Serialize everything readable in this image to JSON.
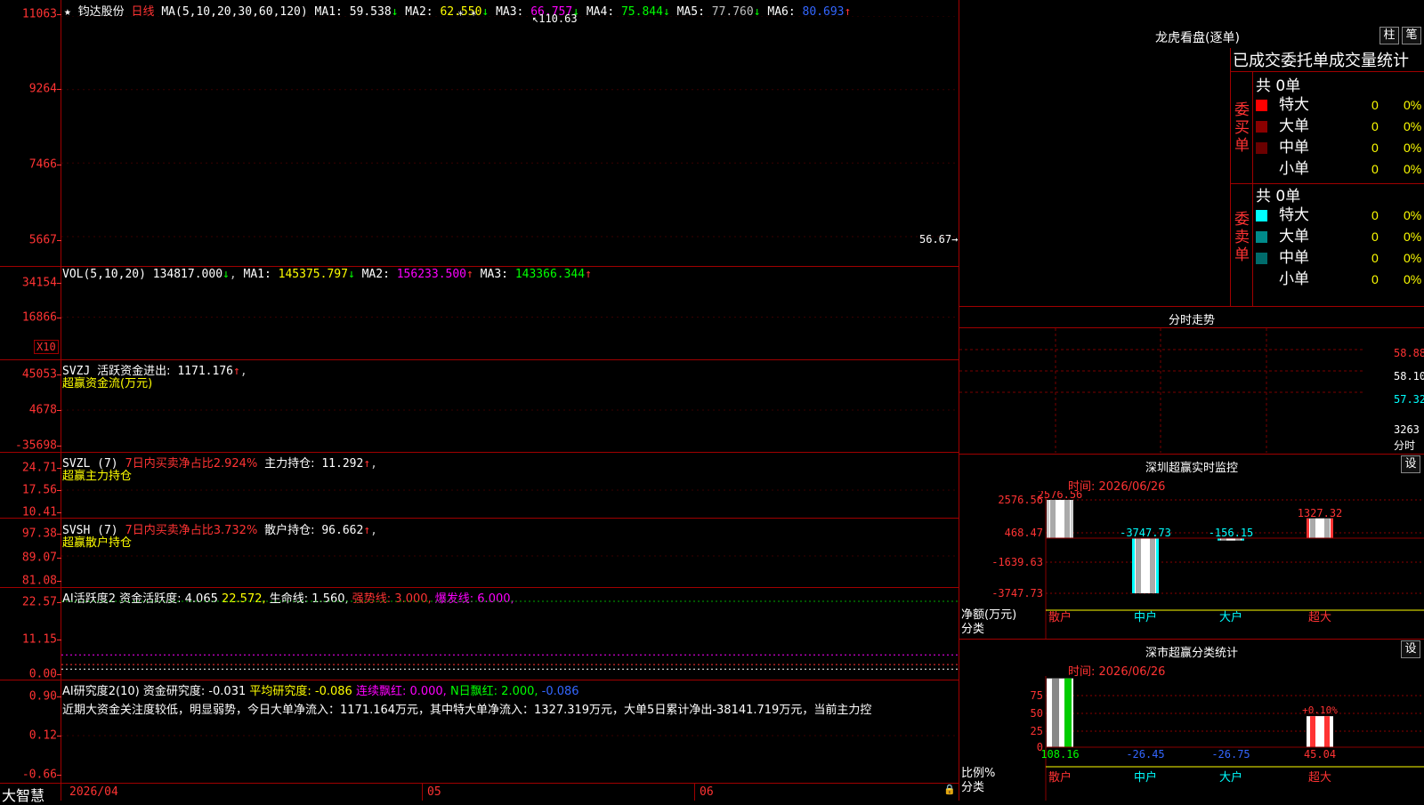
{
  "colors": {
    "up": "#ff3333",
    "down": "#00ffff",
    "grid": "#a00000",
    "ma1": "#ffffff",
    "ma2": "#ffff00",
    "ma3": "#ff00ff",
    "ma4": "#00ff00",
    "ma5": "#c0c0c0",
    "ma6": "#0000ff"
  },
  "kline": {
    "stock_name": "钧达股份",
    "period": "日线",
    "ma_params": "MA(5,10,20,30,60,120)",
    "ma": [
      {
        "label": "MA1:",
        "value": "59.538",
        "arrow": "↓",
        "color": "#ffffff"
      },
      {
        "label": "MA2:",
        "value": "62.550",
        "arrow": "↓",
        "color": "#ffff00"
      },
      {
        "label": "MA3:",
        "value": "66.757",
        "arrow": "↓",
        "color": "#ff00ff"
      },
      {
        "label": "MA4:",
        "value": "75.844",
        "arrow": "↓",
        "color": "#00ff00"
      },
      {
        "label": "MA5:",
        "value": "77.760",
        "arrow": "↓",
        "color": "#c0c0c0"
      },
      {
        "label": "MA6:",
        "value": "80.693",
        "arrow": "↑",
        "color": "#3366ff"
      }
    ],
    "y_labels": [
      "11063",
      "9264",
      "7466",
      "5667"
    ],
    "high_label": "110.63",
    "low_label": "56.67",
    "stars": "* *"
  },
  "vol": {
    "title": "VOL(5,10,20)",
    "vol_value": "134817.000",
    "vol_arrow": "↓",
    "ma": [
      {
        "label": "MA1:",
        "value": "145375.797",
        "arrow": "↓",
        "color": "#ffff00"
      },
      {
        "label": "MA2:",
        "value": "156233.500",
        "arrow": "↑",
        "color": "#ff00ff"
      },
      {
        "label": "MA3:",
        "value": "143366.344",
        "arrow": "↑",
        "color": "#00ff00"
      }
    ],
    "y_labels": [
      "34154",
      "16866"
    ],
    "unit": "X10"
  },
  "svzj": {
    "title": "SVZJ",
    "label": "活跃资金进出:",
    "value": "1171.176",
    "arrow": "↑",
    "subtitle": "超赢资金流(万元)",
    "y_labels": [
      "45053",
      "4678",
      "-35698"
    ]
  },
  "svzl": {
    "title": "SVZL (7)",
    "label1": "7日内买卖净占比2.924%",
    "label2": "主力持仓:",
    "value": "11.292",
    "arrow": "↑",
    "subtitle": "超赢主力持仓",
    "y_labels": [
      "24.71",
      "17.56",
      "10.41"
    ]
  },
  "svsh": {
    "title": "SVSH (7)",
    "label1": "7日内买卖净占比3.732%",
    "label2": "散户持仓:",
    "value": "96.662",
    "arrow": "↑",
    "subtitle": "超赢散户持仓",
    "y_labels": [
      "97.38",
      "89.07",
      "81.08"
    ]
  },
  "ai_active": {
    "title": "AI活跃度2",
    "items": [
      {
        "text": "资金活跃度: 4.065",
        "color": "#ffffff"
      },
      {
        "text": "22.572,",
        "color": "#ffff00"
      },
      {
        "text": "生命线: 1.560,",
        "color": "#ffffff"
      },
      {
        "text": "强势线: 3.000,",
        "color": "#ff3333"
      },
      {
        "text": "爆发线: 6.000,",
        "color": "#ff00ff"
      }
    ],
    "y_labels": [
      "22.57",
      "11.15",
      "0.00"
    ]
  },
  "ai_research": {
    "title": "AI研究度2(10)",
    "items": [
      {
        "text": "资金研究度: -0.031",
        "color": "#ffffff"
      },
      {
        "text": "平均研究度: -0.086",
        "color": "#ffff00"
      },
      {
        "text": "连续飘红: 0.000,",
        "color": "#ff00ff"
      },
      {
        "text": "N日飘红: 2.000,",
        "color": "#00ff00"
      },
      {
        "text": "-0.086",
        "color": "#3366ff"
      }
    ],
    "comment": "近期大资金关注度较低，明显弱势，今日大单净流入：1171.164万元，其中特大单净流入：1327.319万元，大单5日累计净出-38141.719万元，当前主力控",
    "y_labels": [
      "0.90",
      "0.12",
      "-0.66"
    ]
  },
  "time_axis": {
    "labels": [
      "2026/04",
      "05",
      "06"
    ]
  },
  "footer": {
    "brand": "大智慧"
  },
  "right": {
    "lhkp_title": "龙虎看盘(逐单)",
    "buttons": [
      "柱",
      "笔"
    ],
    "stats_title": "已成交委托单成交量统计",
    "buy": {
      "side_label": "委买单",
      "total": "共 0单",
      "rows": [
        {
          "name": "特大",
          "qty": "0",
          "pct": "0%",
          "color": "#ff0000"
        },
        {
          "name": "大单",
          "qty": "0",
          "pct": "0%",
          "color": "#8b0000"
        },
        {
          "name": "中单",
          "qty": "0",
          "pct": "0%",
          "color": "#6b0000"
        },
        {
          "name": "小单",
          "qty": "0",
          "pct": "0%",
          "color": ""
        }
      ]
    },
    "sell": {
      "side_label": "委卖单",
      "total": "共 0单",
      "rows": [
        {
          "name": "特大",
          "qty": "0",
          "pct": "0%",
          "color": "#00ffff"
        },
        {
          "name": "大单",
          "qty": "0",
          "pct": "0%",
          "color": "#008b8b"
        },
        {
          "name": "中单",
          "qty": "0",
          "pct": "0%",
          "color": "#006b6b"
        },
        {
          "name": "小单",
          "qty": "0",
          "pct": "0%",
          "color": ""
        }
      ]
    },
    "intraday": {
      "title": "分时走势",
      "y_labels": [
        "58.88",
        "58.10",
        "57.32"
      ],
      "vol_label": "3263",
      "vol_unit": "分时"
    },
    "monitor": {
      "title": "深圳超赢实时监控",
      "settings_btn": "设",
      "time": "时间: 2026/06/26",
      "y_labels": [
        "2576.56",
        "468.47",
        "-1639.63",
        "-3747.73"
      ],
      "unit_label": "净额(万元)",
      "cat_label": "分类",
      "categories": [
        "散户",
        "中户",
        "大户",
        "超大"
      ],
      "values": [
        "2576.56",
        "-3747.73",
        "-156.15",
        "1327.32"
      ]
    },
    "classstat": {
      "title": "深市超赢分类统计",
      "settings_btn": "设",
      "time": "时间: 2026/06/26",
      "y_labels": [
        "75",
        "50",
        "25",
        "0"
      ],
      "ratio_label": "比例%",
      "cat_label": "分类",
      "categories": [
        "散户",
        "中户",
        "大户",
        "超大"
      ],
      "values": [
        "108.16",
        "-26.45",
        "-26.75",
        "45.04"
      ],
      "top_label": "+0.10%"
    }
  }
}
